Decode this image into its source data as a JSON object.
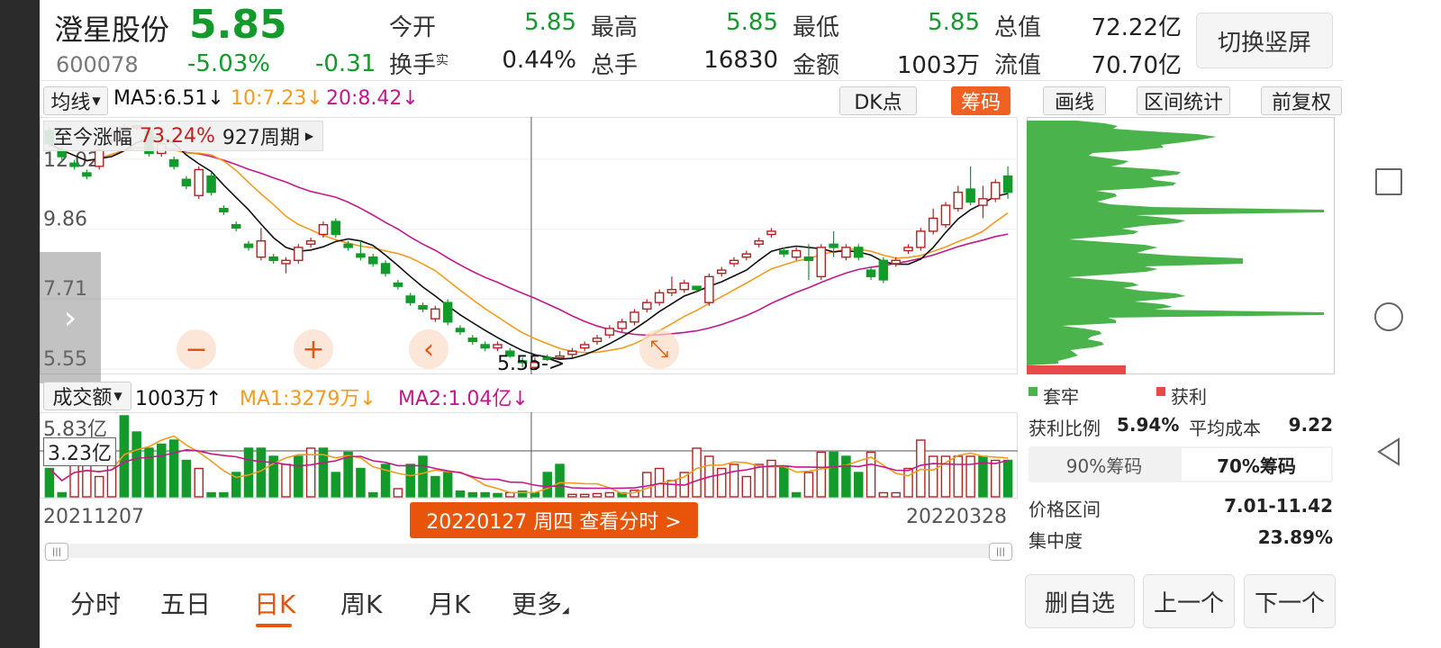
{
  "stock": {
    "name": "澄星股份",
    "price": "5.85",
    "code": "600078",
    "change_pct": "-5.03%",
    "change_amt": "-0.31"
  },
  "quote": {
    "open_label": "今开",
    "open": "5.85",
    "high_label": "最高",
    "high": "5.85",
    "low_label": "最低",
    "low": "5.85",
    "mktcap_label": "总值",
    "mktcap": "72.22亿",
    "turnover_label": "换手",
    "turnover_sup": "实",
    "turnover": "0.44%",
    "volume_label": "总手",
    "volume": "16830",
    "amount_label": "金额",
    "amount": "1003万",
    "float_label": "流值",
    "float_cap": "70.70亿"
  },
  "switch_label": "切换竖屏",
  "toolbar": {
    "ma_select": "均线",
    "ma5": "MA5:6.51↓",
    "ma10": "10:7.23↓",
    "ma20": "20:8.42↓",
    "dk": "DK点",
    "chips": "筹码",
    "draw": "画线",
    "range_stat": "区间统计",
    "adjust": "前复权"
  },
  "chart_overlay": {
    "gain_label": "至今涨幅",
    "gain_value": "73.24%",
    "periods": "927周期",
    "low_marker": "5.55->"
  },
  "chart_data": {
    "type": "candlestick",
    "y_ticks": [
      "12.02",
      "9.86",
      "7.71",
      "5.55"
    ],
    "ylim": [
      5.55,
      13.1
    ],
    "x_labels": [
      "20211207",
      "20220328"
    ],
    "ohlc": [
      [
        12.9,
        12.5,
        13.0,
        12.4
      ],
      [
        12.3,
        12.1,
        12.4,
        12.0
      ],
      [
        11.9,
        11.8,
        12.0,
        11.7
      ],
      [
        11.6,
        11.5,
        11.7,
        11.4
      ],
      [
        11.8,
        12.3,
        12.4,
        11.7
      ],
      [
        12.6,
        12.8,
        12.9,
        12.5
      ],
      [
        12.9,
        13.0,
        13.1,
        12.8
      ],
      [
        13.0,
        13.05,
        13.1,
        12.9
      ],
      [
        12.9,
        12.2,
        13.0,
        12.1
      ],
      [
        12.2,
        12.5,
        12.6,
        12.1
      ],
      [
        12.0,
        11.8,
        12.1,
        11.7
      ],
      [
        11.4,
        11.2,
        11.5,
        11.1
      ],
      [
        10.9,
        11.7,
        11.8,
        10.8
      ],
      [
        11.5,
        11.0,
        11.6,
        10.9
      ],
      [
        10.5,
        10.4,
        10.6,
        10.3
      ],
      [
        10.0,
        9.9,
        10.1,
        9.8
      ],
      [
        9.4,
        9.3,
        9.5,
        9.2
      ],
      [
        9.0,
        9.5,
        9.9,
        8.9
      ],
      [
        9.0,
        8.9,
        9.1,
        8.8
      ],
      [
        8.8,
        8.9,
        9.0,
        8.5
      ],
      [
        8.9,
        9.3,
        9.4,
        8.8
      ],
      [
        9.4,
        9.5,
        9.6,
        9.3
      ],
      [
        9.7,
        10.0,
        10.1,
        9.6
      ],
      [
        10.1,
        9.7,
        10.2,
        9.6
      ],
      [
        9.4,
        9.3,
        9.5,
        9.2
      ],
      [
        9.1,
        9.0,
        9.5,
        8.9
      ],
      [
        9.0,
        8.8,
        9.1,
        8.7
      ],
      [
        8.8,
        8.5,
        8.9,
        8.4
      ],
      [
        8.2,
        8.1,
        8.3,
        8.0
      ],
      [
        7.8,
        7.6,
        7.9,
        7.5
      ],
      [
        7.5,
        7.4,
        7.6,
        7.3
      ],
      [
        7.1,
        7.4,
        7.5,
        7.0
      ],
      [
        7.6,
        7.0,
        7.7,
        6.9
      ],
      [
        6.8,
        6.7,
        6.9,
        6.6
      ],
      [
        6.5,
        6.4,
        6.6,
        6.3
      ],
      [
        6.3,
        6.2,
        6.4,
        6.1
      ],
      [
        6.2,
        6.3,
        6.4,
        6.1
      ],
      [
        6.1,
        5.95,
        6.2,
        5.9
      ],
      [
        5.8,
        5.75,
        5.9,
        5.6
      ],
      [
        5.6,
        5.75,
        5.9,
        5.55
      ],
      [
        5.9,
        5.85,
        6.0,
        5.8
      ],
      [
        5.9,
        5.95,
        6.1,
        5.9
      ],
      [
        6.0,
        6.1,
        6.2,
        5.9
      ],
      [
        6.2,
        6.3,
        6.4,
        6.1
      ],
      [
        6.4,
        6.5,
        6.6,
        6.3
      ],
      [
        6.6,
        6.8,
        6.9,
        6.5
      ],
      [
        6.8,
        7.0,
        7.1,
        6.7
      ],
      [
        7.0,
        7.3,
        7.4,
        6.9
      ],
      [
        7.4,
        7.6,
        7.7,
        7.3
      ],
      [
        7.6,
        7.9,
        8.0,
        7.5
      ],
      [
        7.9,
        8.0,
        8.4,
        7.8
      ],
      [
        8.0,
        8.2,
        8.3,
        7.9
      ],
      [
        8.1,
        8.0,
        8.1,
        7.9
      ],
      [
        7.6,
        8.4,
        8.5,
        7.5
      ],
      [
        8.5,
        8.6,
        8.7,
        8.4
      ],
      [
        8.8,
        8.9,
        9.0,
        8.7
      ],
      [
        9.0,
        9.1,
        9.2,
        8.9
      ],
      [
        9.4,
        9.5,
        9.6,
        9.3
      ],
      [
        9.7,
        9.8,
        9.9,
        9.6
      ],
      [
        9.2,
        9.1,
        9.3,
        9.0
      ],
      [
        9.0,
        9.2,
        9.3,
        8.9
      ],
      [
        9.0,
        8.9,
        9.4,
        8.3
      ],
      [
        8.4,
        9.3,
        9.4,
        8.3
      ],
      [
        9.4,
        9.3,
        9.8,
        9.0
      ],
      [
        9.0,
        9.3,
        9.4,
        8.9
      ],
      [
        9.3,
        9.0,
        9.4,
        8.9
      ],
      [
        8.6,
        8.4,
        8.7,
        8.3
      ],
      [
        8.9,
        8.3,
        9.0,
        8.2
      ],
      [
        8.8,
        8.9,
        9.0,
        8.7
      ],
      [
        9.2,
        9.3,
        9.4,
        9.1
      ],
      [
        9.3,
        9.8,
        9.9,
        9.2
      ],
      [
        9.8,
        10.2,
        10.5,
        9.7
      ],
      [
        10.0,
        10.6,
        10.7,
        9.9
      ],
      [
        10.5,
        11.0,
        11.2,
        10.4
      ],
      [
        11.1,
        10.7,
        11.8,
        10.6
      ],
      [
        10.6,
        10.8,
        11.2,
        10.2
      ],
      [
        10.8,
        11.3,
        11.4,
        10.7
      ],
      [
        11.5,
        11.0,
        11.8,
        10.8
      ]
    ],
    "volume_label": "成交额",
    "volume_value": "1003万↑",
    "ma1": "MA1:3279万↓",
    "ma2": "MA2:1.04亿↓",
    "vol_tick_top": "5.83亿",
    "vol_crosshair": "3.23亿",
    "volume": [
      [
        0.35,
        0
      ],
      [
        0.05,
        0
      ],
      [
        0.5,
        1
      ],
      [
        0.4,
        1
      ],
      [
        0.25,
        1
      ],
      [
        0.45,
        1
      ],
      [
        1.0,
        0
      ],
      [
        0.8,
        0
      ],
      [
        0.6,
        0
      ],
      [
        0.65,
        0
      ],
      [
        0.7,
        0
      ],
      [
        0.45,
        0
      ],
      [
        0.35,
        1
      ],
      [
        0.05,
        0
      ],
      [
        0.05,
        0
      ],
      [
        0.3,
        0
      ],
      [
        0.6,
        0
      ],
      [
        0.6,
        0
      ],
      [
        0.5,
        0
      ],
      [
        0.4,
        1
      ],
      [
        0.5,
        0
      ],
      [
        0.6,
        1
      ],
      [
        0.6,
        0
      ],
      [
        0.3,
        0
      ],
      [
        0.55,
        0
      ],
      [
        0.35,
        0
      ],
      [
        0.05,
        0
      ],
      [
        0.4,
        0
      ],
      [
        0.1,
        1
      ],
      [
        0.4,
        0
      ],
      [
        0.5,
        0
      ],
      [
        0.25,
        0
      ],
      [
        0.3,
        0
      ],
      [
        0.07,
        0
      ],
      [
        0.05,
        0
      ],
      [
        0.05,
        0
      ],
      [
        0.04,
        0
      ],
      [
        0.05,
        1
      ],
      [
        0.07,
        0
      ],
      [
        0.05,
        0
      ],
      [
        0.3,
        0
      ],
      [
        0.4,
        0
      ],
      [
        0.03,
        1
      ],
      [
        0.03,
        1
      ],
      [
        0.04,
        1
      ],
      [
        0.05,
        1
      ],
      [
        0.05,
        0
      ],
      [
        0.08,
        1
      ],
      [
        0.3,
        1
      ],
      [
        0.35,
        1
      ],
      [
        0.2,
        1
      ],
      [
        0.3,
        1
      ],
      [
        0.6,
        1
      ],
      [
        0.5,
        1
      ],
      [
        0.35,
        1
      ],
      [
        0.4,
        1
      ],
      [
        0.25,
        1
      ],
      [
        0.4,
        1
      ],
      [
        0.45,
        1
      ],
      [
        0.38,
        0
      ],
      [
        0.05,
        0
      ],
      [
        0.3,
        1
      ],
      [
        0.55,
        1
      ],
      [
        0.55,
        0
      ],
      [
        0.5,
        0
      ],
      [
        0.3,
        0
      ],
      [
        0.55,
        1
      ],
      [
        0.05,
        1
      ],
      [
        0.05,
        1
      ],
      [
        0.35,
        1
      ],
      [
        0.7,
        1
      ],
      [
        0.5,
        1
      ],
      [
        0.5,
        1
      ],
      [
        0.5,
        1
      ],
      [
        0.5,
        1
      ],
      [
        0.5,
        0
      ],
      [
        0.45,
        1
      ],
      [
        0.45,
        0
      ]
    ]
  },
  "date_badge": "20220127 周四 查看分时 >",
  "chip_panel": {
    "legend_trapped": "套牢",
    "legend_profit": "获利",
    "profit_ratio_label": "获利比例",
    "profit_ratio": "5.94%",
    "avg_cost_label": "平均成本",
    "avg_cost": "9.22",
    "tab90": "90%筹码",
    "tab70": "70%筹码",
    "price_range_label": "价格区间",
    "price_range": "7.01-11.42",
    "concentration_label": "集中度",
    "concentration": "23.89%"
  },
  "tabs": [
    "分时",
    "五日",
    "日K",
    "周K",
    "月K",
    "更多"
  ],
  "active_tab": 2,
  "bottom_buttons": {
    "remove": "删自选",
    "prev": "上一个",
    "next": "下一个"
  },
  "colors": {
    "up": "#b22222",
    "down": "#129a2b",
    "ma5": "#111111",
    "ma10": "#f29b1e",
    "ma20": "#c2188e",
    "accent": "#e8540a"
  }
}
